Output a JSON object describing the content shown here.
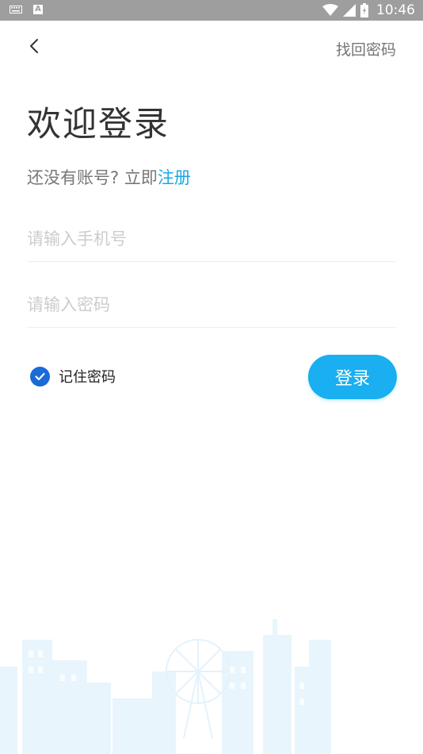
{
  "status_bar": {
    "time": "10:46",
    "icons": [
      "keyboard-icon",
      "a-notification-icon",
      "wifi-icon",
      "signal-icon",
      "battery-icon"
    ]
  },
  "header": {
    "back_icon": "chevron-left-icon",
    "forgot_password_label": "找回密码"
  },
  "main": {
    "title": "欢迎登录",
    "subtitle_prefix": "还没有账号? 立即",
    "register_link": "注册",
    "phone_placeholder": "请输入手机号",
    "phone_value": "",
    "password_placeholder": "请输入密码",
    "password_value": "",
    "remember_label": "记住密码",
    "remember_checked": true,
    "login_button": "登录"
  },
  "colors": {
    "accent": "#19aff0",
    "link": "#19a6e6",
    "checkbox": "#1a6ad8",
    "status_bar": "#9e9e9e"
  }
}
